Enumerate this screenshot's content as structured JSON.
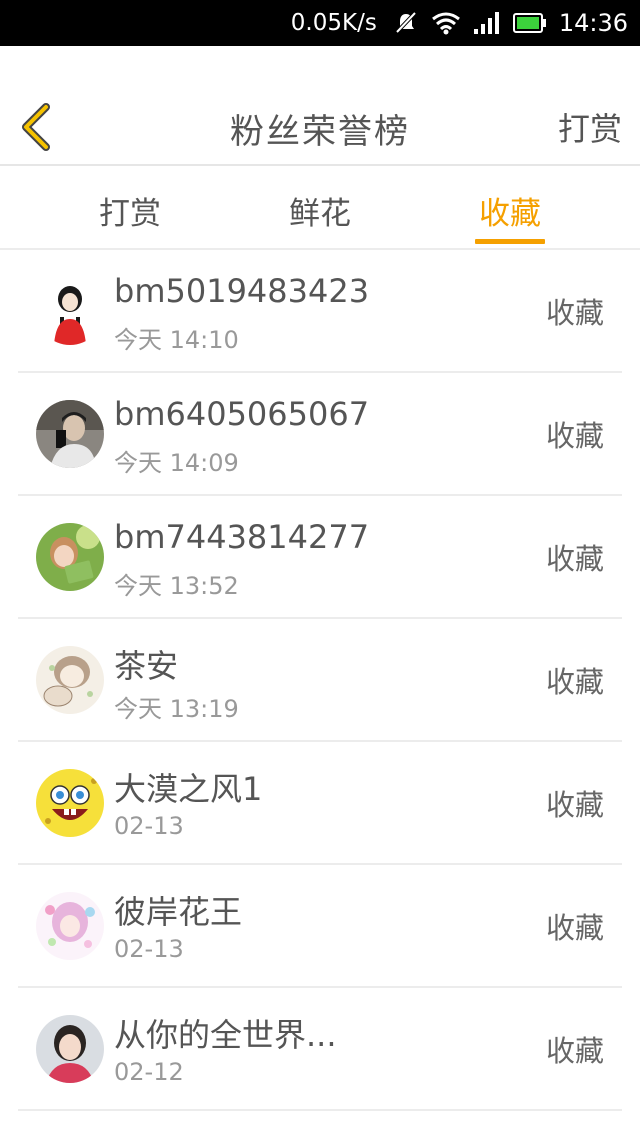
{
  "status_bar": {
    "speed": "0.05K/s",
    "time": "14:36",
    "icons": [
      "mute-icon",
      "wifi-icon",
      "signal-icon",
      "battery-icon"
    ]
  },
  "header": {
    "title": "粉丝荣誉榜",
    "action_label": "打赏",
    "back_icon": "chevron-left-icon",
    "accent": "#f5a000"
  },
  "tabs": [
    {
      "label": "打赏",
      "active": false
    },
    {
      "label": "鲜花",
      "active": false
    },
    {
      "label": "收藏",
      "active": true
    }
  ],
  "list": [
    {
      "name": "bm5019483423",
      "time": "今天 14:10",
      "action": "收藏",
      "avatar": "avatar-girl-red"
    },
    {
      "name": "bm6405065067",
      "time": "今天 14:09",
      "action": "收藏",
      "avatar": "avatar-selfie"
    },
    {
      "name": "bm7443814277",
      "time": "今天 13:52",
      "action": "收藏",
      "avatar": "avatar-reading"
    },
    {
      "name": "茶安",
      "time": "今天 13:19",
      "action": "收藏",
      "avatar": "avatar-anime-sketch"
    },
    {
      "name": "大漠之风1",
      "time": "02-13",
      "action": "收藏",
      "avatar": "avatar-spongebob"
    },
    {
      "name": "彼岸花王",
      "time": "02-13",
      "action": "收藏",
      "avatar": "avatar-anime-flower"
    },
    {
      "name": "从你的全世界...",
      "time": "02-12",
      "action": "收藏",
      "avatar": "avatar-girl-photo"
    }
  ]
}
